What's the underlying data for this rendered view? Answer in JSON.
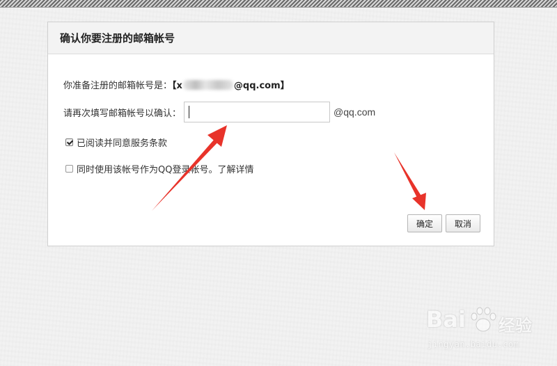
{
  "dialog": {
    "title": "确认你要注册的邮箱帐号",
    "email_prompt": "你准备注册的邮箱帐号是：",
    "email_open_bracket": "【",
    "email_visible_prefix": "x",
    "email_domain_part": "@qq.com",
    "email_close_bracket": "】",
    "confirm_label": "请再次填写邮箱帐号以确认：",
    "confirm_input_value": "",
    "confirm_suffix": "@qq.com",
    "agree_terms_label": "已阅读并同意服务条款",
    "agree_terms_checked": true,
    "qq_login_label": "同时使用该帐号作为QQ登录帐号。",
    "qq_login_checked": false,
    "learn_more_link": "了解详情",
    "ok_button": "确定",
    "cancel_button": "取消"
  },
  "annotations": {
    "arrow_color": "#e8332a"
  },
  "watermark": {
    "logo": "Bai",
    "logo_suffix": "经验",
    "url": "jingyan.baidu.com"
  }
}
